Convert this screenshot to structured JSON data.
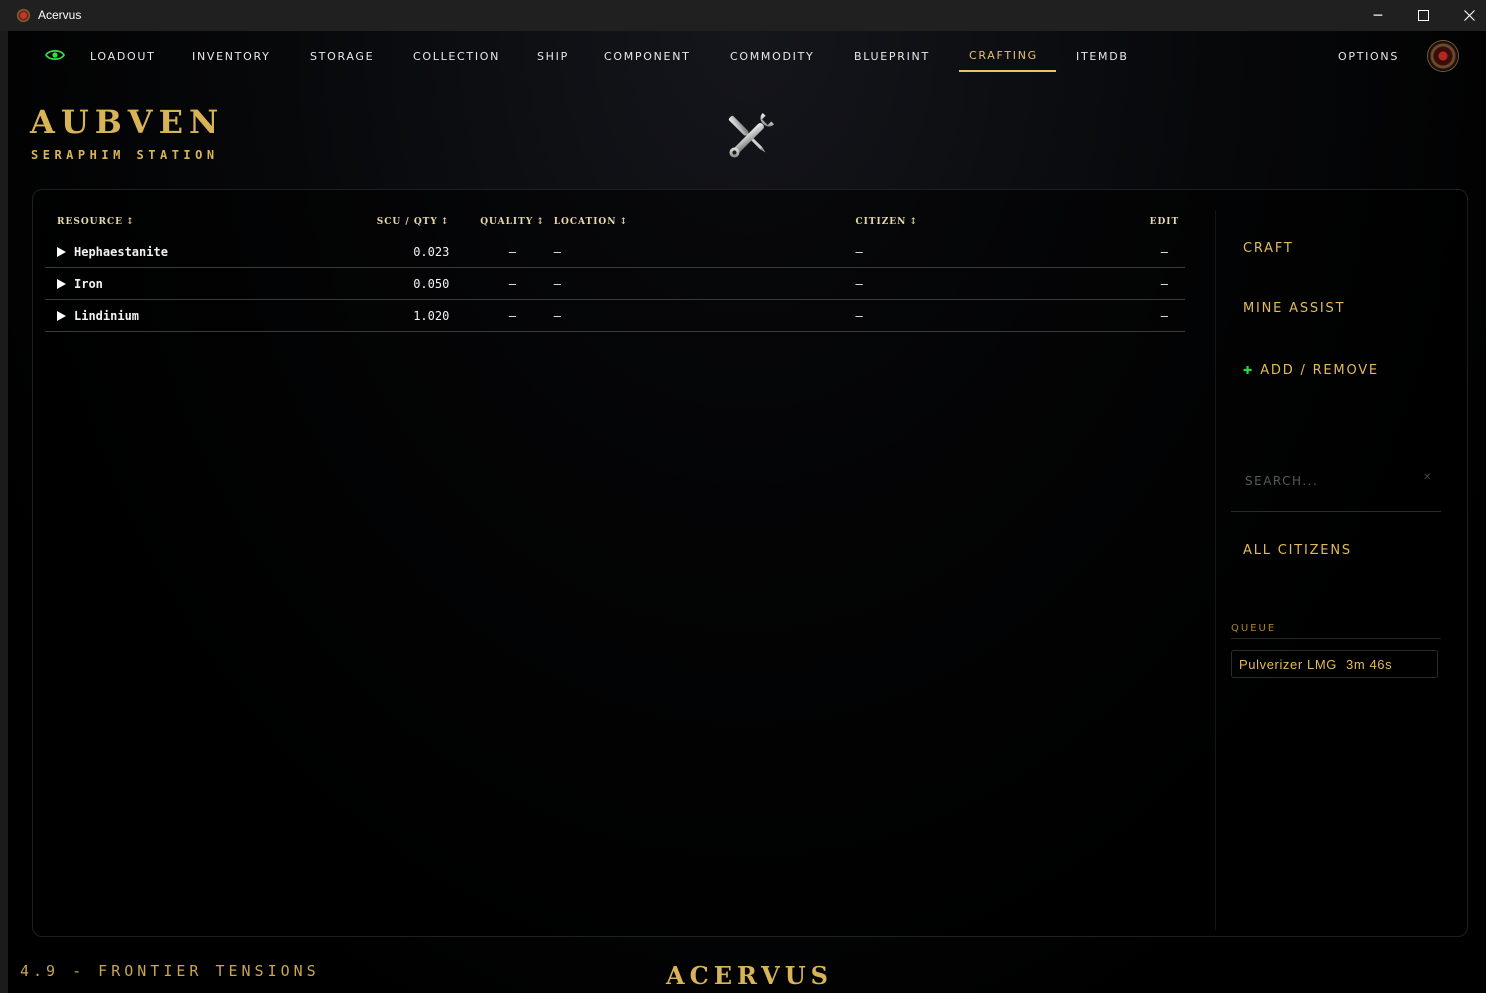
{
  "window": {
    "title": "Acervus",
    "icon": "acervus-emblem-icon"
  },
  "nav": {
    "items": [
      {
        "label": "LOADOUT"
      },
      {
        "label": "INVENTORY"
      },
      {
        "label": "STORAGE"
      },
      {
        "label": "COLLECTION"
      },
      {
        "label": "SHIP"
      },
      {
        "label": "COMPONENT"
      },
      {
        "label": "COMMODITY"
      },
      {
        "label": "BLUEPRINT"
      },
      {
        "label": "CRAFTING"
      },
      {
        "label": "ITEMDB"
      }
    ],
    "active": "CRAFTING",
    "options_label": "OPTIONS",
    "accent_color": "#e7c36a",
    "eye_color": "#2ee04a"
  },
  "header": {
    "location": "AUBVEN",
    "station": "SERAPHIM STATION",
    "icon": "tools-icon"
  },
  "table": {
    "columns": [
      "RESOURCE",
      "SCU / QTY",
      "QUALITY",
      "LOCATION",
      "CITIZEN",
      "EDIT"
    ],
    "rows": [
      {
        "resource": "Hephaestanite",
        "qty": "0.023",
        "quality": "–",
        "location": "–",
        "citizen": "–",
        "edit": "–"
      },
      {
        "resource": "Iron",
        "qty": "0.050",
        "quality": "–",
        "location": "–",
        "citizen": "–",
        "edit": "–"
      },
      {
        "resource": "Lindinium",
        "qty": "1.020",
        "quality": "–",
        "location": "–",
        "citizen": "–",
        "edit": "–"
      }
    ]
  },
  "side": {
    "craft": "CRAFT",
    "mine_assist": "MINE ASSIST",
    "add_remove": "ADD / REMOVE",
    "search_placeholder": "SEARCH...",
    "citizens": "ALL CITIZENS",
    "queue_label": "QUEUE",
    "queue": [
      {
        "item": "Pulverizer LMG",
        "time": "3m 46s"
      }
    ]
  },
  "footer": {
    "version": "4.9 - FRONTIER TENSIONS",
    "brand": "ACERVUS"
  },
  "colors": {
    "gold": "#d9b457",
    "text": "#e6e6e6",
    "background": "#000000"
  }
}
